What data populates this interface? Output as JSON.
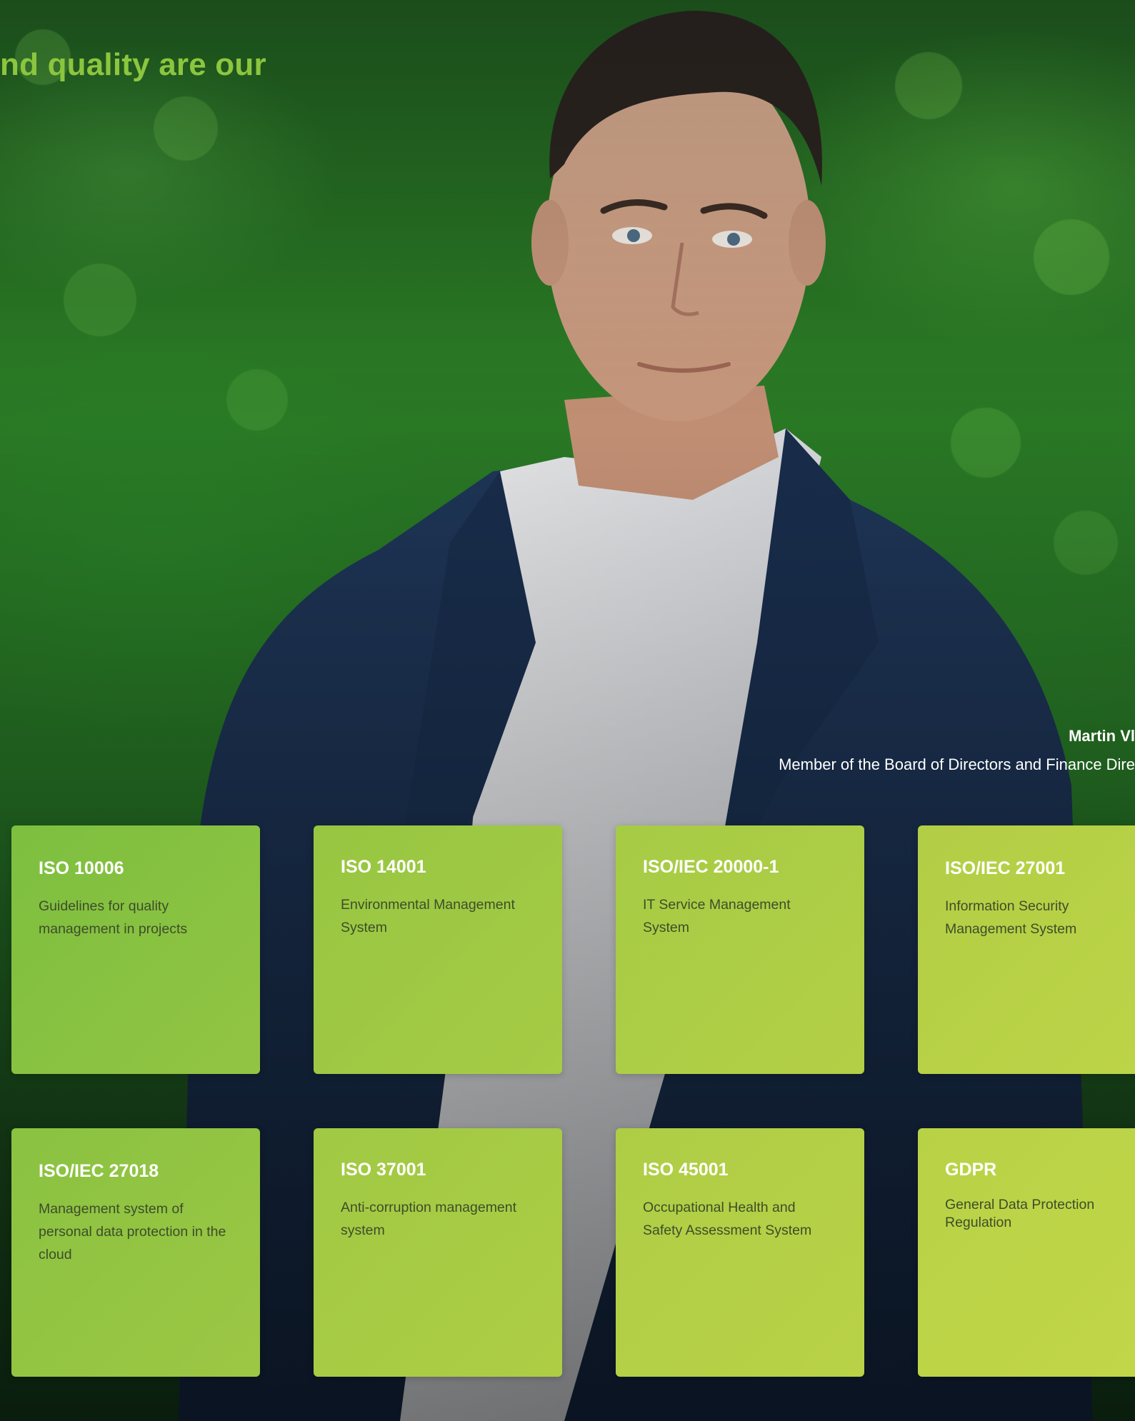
{
  "hero": {
    "headline": "nd quality are our"
  },
  "quote": {
    "author_name": "Martin Vl",
    "author_role": "Member of the Board of Directors and Finance Dire"
  },
  "certifications": [
    {
      "title": "ISO 10006",
      "description": "Guidelines for quality management in projects"
    },
    {
      "title": "ISO 14001",
      "description": "Environmental Management System"
    },
    {
      "title": "ISO/IEC 20000-1",
      "description": "IT Service Management System"
    },
    {
      "title": "ISO/IEC 27001",
      "description": "Information Security Management System"
    },
    {
      "title": "ISO/IEC 27018",
      "description": "Management system of personal data protection in the cloud"
    },
    {
      "title": "ISO 37001",
      "description": "Anti-corruption management system"
    },
    {
      "title": "ISO 45001",
      "description": "Occupational Health and Safety Assessment System"
    },
    {
      "title": "GDPR",
      "description": "General Data Protection Regulation"
    }
  ],
  "colors": {
    "accent": "#8cc63f",
    "background": "#236b22",
    "card_text_dark": "#3d4d2a"
  }
}
